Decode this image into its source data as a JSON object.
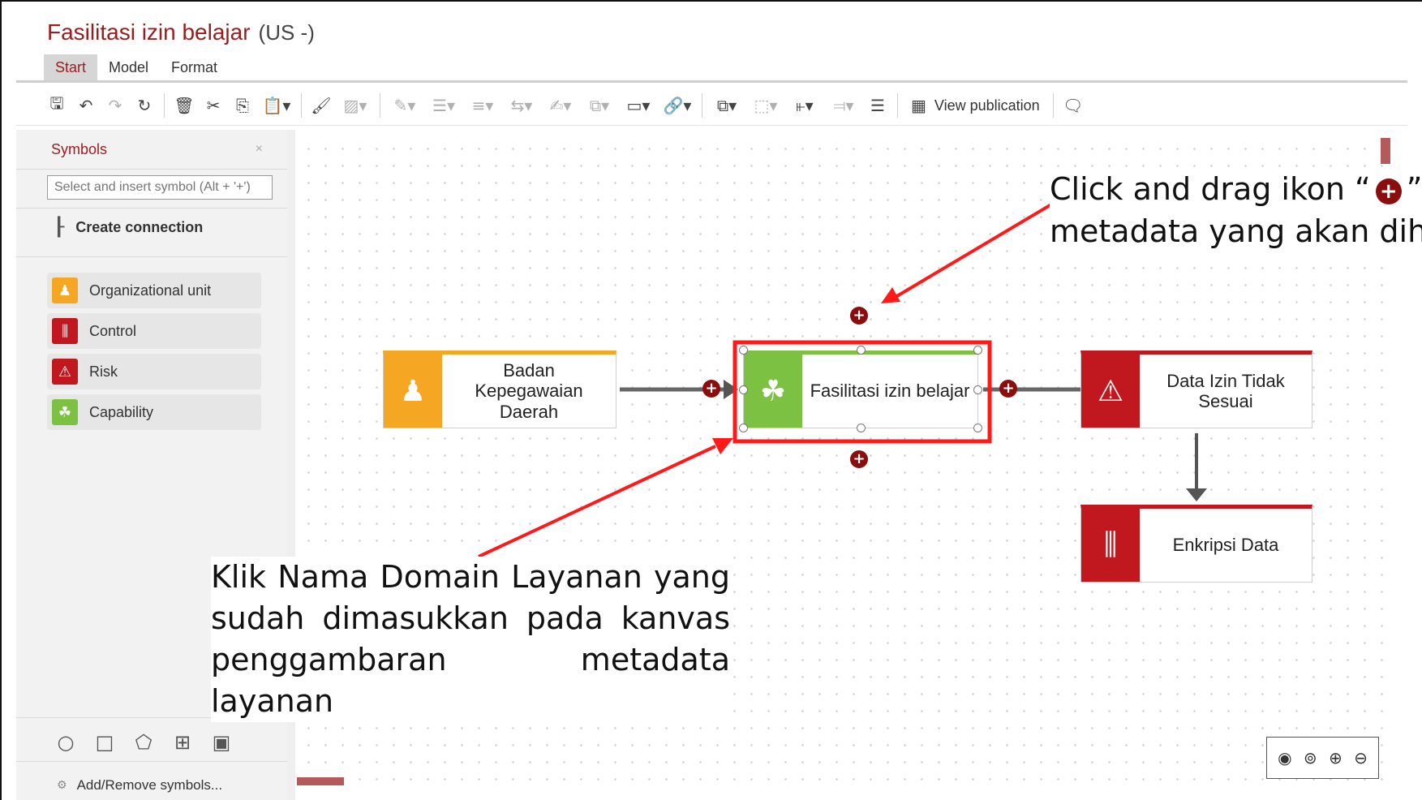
{
  "header": {
    "title": "Fasilitasi izin belajar",
    "language": "(US -)"
  },
  "tabs": [
    {
      "label": "Start",
      "active": true
    },
    {
      "label": "Model",
      "active": false
    },
    {
      "label": "Format",
      "active": false
    }
  ],
  "toolbar": {
    "icons": [
      "save-icon",
      "undo-icon",
      "redo-icon",
      "refresh-icon",
      "delete-icon",
      "cut-icon",
      "copy-icon",
      "paste-icon",
      "format-painter-icon",
      "fill-color-icon",
      "line-color-icon",
      "line-style-icon",
      "line-weight-icon",
      "arrow-style-icon",
      "edit-shape-icon",
      "shape-style-icon",
      "callout-icon",
      "link-icon",
      "group-icon",
      "select-icon",
      "align-icon",
      "distribute-icon",
      "stack-icon",
      "view-publication-icon",
      "comment-icon"
    ],
    "view_publication_label": "View publication"
  },
  "sidebar": {
    "title": "Symbols",
    "close_symbol": "×",
    "search_placeholder": "Select and insert symbol (Alt + '+')",
    "create_connection_label": "Create connection",
    "symbols": [
      {
        "label": "Organizational unit",
        "color": "#f5a623",
        "icon": "org-unit-icon"
      },
      {
        "label": "Control",
        "color": "#c0181e",
        "icon": "control-icon"
      },
      {
        "label": "Risk",
        "color": "#c0181e",
        "icon": "risk-icon"
      },
      {
        "label": "Capability",
        "color": "#7cc142",
        "icon": "capability-icon"
      }
    ],
    "shape_tools": [
      "circle-icon",
      "rectangle-icon",
      "pentagon-icon",
      "text-box-icon",
      "image-icon"
    ],
    "add_remove_label": "Add/Remove symbols..."
  },
  "canvas": {
    "nodes": [
      {
        "id": "org",
        "label": "Badan Kepegawaian Daerah",
        "type": "Organizational unit",
        "color": "#f5a623",
        "icon": "org-unit-icon"
      },
      {
        "id": "cap",
        "label": "Fasilitasi izin belajar",
        "type": "Capability",
        "color": "#7cc142",
        "icon": "capability-icon",
        "selected": true
      },
      {
        "id": "risk",
        "label": "Data Izin Tidak Sesuai",
        "type": "Risk",
        "color": "#c0181e",
        "icon": "risk-icon"
      },
      {
        "id": "ctrl",
        "label": "Enkripsi Data",
        "type": "Control",
        "color": "#c0181e",
        "icon": "control-icon"
      }
    ],
    "plus_symbol": "+",
    "zoom_controls": [
      "eye-icon",
      "zoom-100-icon",
      "zoom-in-icon",
      "zoom-out-icon"
    ]
  },
  "annotations": {
    "right_line1": "Click and drag ikon “",
    "right_icon_glyph": "+",
    "right_line1_end": "”",
    "right_line2": "metadata yang akan dih",
    "left_lines": [
      "Klik Nama Domain Layanan yang",
      "sudah dimasukkan pada kanvas",
      "penggambaran metadata layanan"
    ],
    "highlight_color": "#ff1a1a"
  }
}
